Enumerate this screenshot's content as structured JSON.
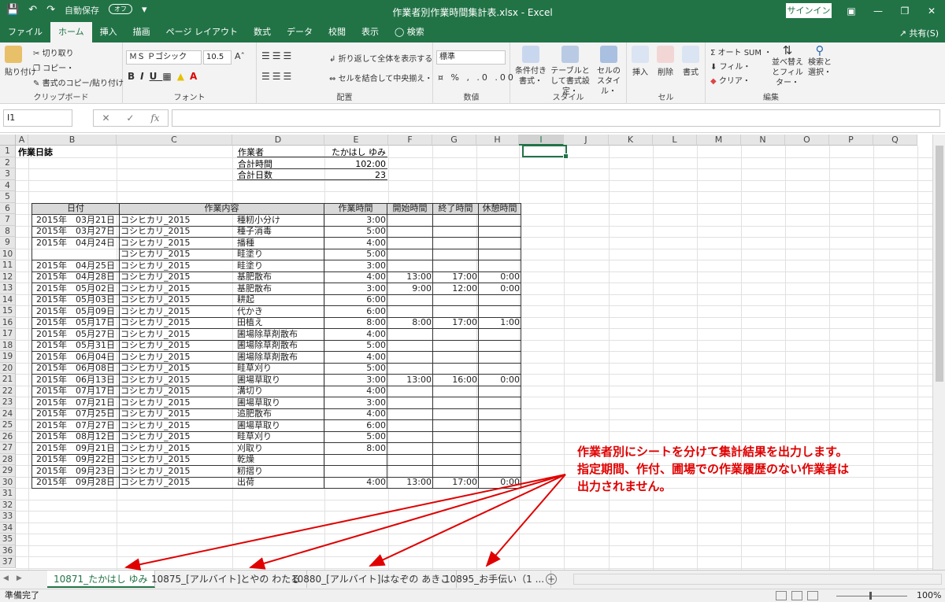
{
  "window": {
    "title": "作業者別作業時間集計表.xlsx  -  Excel",
    "autosave_label": "自動保存",
    "autosave_state": "オフ",
    "signin_label": "サインイン"
  },
  "menu": {
    "tabs": [
      "ファイル",
      "ホーム",
      "挿入",
      "描画",
      "ページ レイアウト",
      "数式",
      "データ",
      "校閲",
      "表示",
      "検索"
    ],
    "share_label": "共有(S)"
  },
  "ribbon": {
    "clipboard": {
      "paste": "貼り付け",
      "cut": "切り取り",
      "copy": "コピー・",
      "format_painter": "書式のコピー/貼り付け",
      "label": "クリップボード"
    },
    "font": {
      "name": "ＭＳ Ｐゴシック",
      "size": "10.5",
      "label": "フォント"
    },
    "alignment": {
      "wrap": "折り返して全体を表示する",
      "merge": "セルを結合して中央揃え・",
      "label": "配置"
    },
    "number": {
      "format": "標準",
      "label": "数値"
    },
    "styles": {
      "cond": "条件付き書式・",
      "table": "テーブルとして書式設定・",
      "cell": "セルのスタイル・",
      "label": "スタイル"
    },
    "cells": {
      "insert": "挿入",
      "delete": "削除",
      "format": "書式",
      "label": "セル"
    },
    "editing": {
      "autosum": "オート SUM ・",
      "fill": "フィル・",
      "clear": "クリア・",
      "sort": "並べ替えとフィルター・",
      "find": "検索と選択・",
      "label": "編集"
    }
  },
  "formula_bar": {
    "name_box": "I1",
    "cancel": "✕",
    "enter": "✓",
    "fx": "fx",
    "formula": ""
  },
  "columns": [
    "A",
    "B",
    "C",
    "D",
    "E",
    "F",
    "G",
    "H",
    "I",
    "J",
    "K",
    "L",
    "M",
    "N",
    "O",
    "P",
    "Q"
  ],
  "rows": [
    "1",
    "2",
    "3",
    "4",
    "5",
    "6",
    "7",
    "8",
    "9",
    "10",
    "11",
    "12",
    "13",
    "14",
    "15",
    "16",
    "17",
    "18",
    "19",
    "20",
    "21",
    "22",
    "23",
    "24",
    "25",
    "26",
    "27",
    "28",
    "29",
    "30",
    "31",
    "32",
    "33",
    "34",
    "35",
    "36",
    "37"
  ],
  "sheet": {
    "title": "作業日誌",
    "summary": [
      {
        "label": "作業者",
        "value": "たかはし ゆみ"
      },
      {
        "label": "合計時間",
        "value": "102:00"
      },
      {
        "label": "合計日数",
        "value": "23"
      }
    ],
    "headers": [
      "日付",
      "作業内容",
      "作業時間",
      "開始時間",
      "終了時間",
      "休憩時間"
    ],
    "records": [
      {
        "date": "2015年　03月21日",
        "crop": "コシヒカリ_2015",
        "task": "種籾小分け",
        "hours": "3:00",
        "start": "",
        "end": "",
        "break": ""
      },
      {
        "date": "2015年　03月27日",
        "crop": "コシヒカリ_2015",
        "task": "種子消毒",
        "hours": "5:00",
        "start": "",
        "end": "",
        "break": ""
      },
      {
        "date": "2015年　04月24日",
        "crop": "コシヒカリ_2015",
        "task": "播種",
        "hours": "4:00",
        "start": "",
        "end": "",
        "break": ""
      },
      {
        "date": "",
        "crop": "コシヒカリ_2015",
        "task": "畦塗り",
        "hours": "5:00",
        "start": "",
        "end": "",
        "break": ""
      },
      {
        "date": "2015年　04月25日",
        "crop": "コシヒカリ_2015",
        "task": "畦塗り",
        "hours": "3:00",
        "start": "",
        "end": "",
        "break": ""
      },
      {
        "date": "2015年　04月28日",
        "crop": "コシヒカリ_2015",
        "task": "基肥散布",
        "hours": "4:00",
        "start": "13:00",
        "end": "17:00",
        "break": "0:00"
      },
      {
        "date": "2015年　05月02日",
        "crop": "コシヒカリ_2015",
        "task": "基肥散布",
        "hours": "3:00",
        "start": "9:00",
        "end": "12:00",
        "break": "0:00"
      },
      {
        "date": "2015年　05月03日",
        "crop": "コシヒカリ_2015",
        "task": "耕起",
        "hours": "6:00",
        "start": "",
        "end": "",
        "break": ""
      },
      {
        "date": "2015年　05月09日",
        "crop": "コシヒカリ_2015",
        "task": "代かき",
        "hours": "6:00",
        "start": "",
        "end": "",
        "break": ""
      },
      {
        "date": "2015年　05月17日",
        "crop": "コシヒカリ_2015",
        "task": "田植え",
        "hours": "8:00",
        "start": "8:00",
        "end": "17:00",
        "break": "1:00"
      },
      {
        "date": "2015年　05月27日",
        "crop": "コシヒカリ_2015",
        "task": "圃場除草剤散布",
        "hours": "4:00",
        "start": "",
        "end": "",
        "break": ""
      },
      {
        "date": "2015年　05月31日",
        "crop": "コシヒカリ_2015",
        "task": "圃場除草剤散布",
        "hours": "5:00",
        "start": "",
        "end": "",
        "break": ""
      },
      {
        "date": "2015年　06月04日",
        "crop": "コシヒカリ_2015",
        "task": "圃場除草剤散布",
        "hours": "4:00",
        "start": "",
        "end": "",
        "break": ""
      },
      {
        "date": "2015年　06月08日",
        "crop": "コシヒカリ_2015",
        "task": "畦草刈り",
        "hours": "5:00",
        "start": "",
        "end": "",
        "break": ""
      },
      {
        "date": "2015年　06月13日",
        "crop": "コシヒカリ_2015",
        "task": "圃場草取り",
        "hours": "3:00",
        "start": "13:00",
        "end": "16:00",
        "break": "0:00"
      },
      {
        "date": "2015年　07月17日",
        "crop": "コシヒカリ_2015",
        "task": "溝切り",
        "hours": "4:00",
        "start": "",
        "end": "",
        "break": ""
      },
      {
        "date": "2015年　07月21日",
        "crop": "コシヒカリ_2015",
        "task": "圃場草取り",
        "hours": "3:00",
        "start": "",
        "end": "",
        "break": ""
      },
      {
        "date": "2015年　07月25日",
        "crop": "コシヒカリ_2015",
        "task": "追肥散布",
        "hours": "4:00",
        "start": "",
        "end": "",
        "break": ""
      },
      {
        "date": "2015年　07月27日",
        "crop": "コシヒカリ_2015",
        "task": "圃場草取り",
        "hours": "6:00",
        "start": "",
        "end": "",
        "break": ""
      },
      {
        "date": "2015年　08月12日",
        "crop": "コシヒカリ_2015",
        "task": "畦草刈り",
        "hours": "5:00",
        "start": "",
        "end": "",
        "break": ""
      },
      {
        "date": "2015年　09月21日",
        "crop": "コシヒカリ_2015",
        "task": "刈取り",
        "hours": "8:00",
        "start": "",
        "end": "",
        "break": ""
      },
      {
        "date": "2015年　09月22日",
        "crop": "コシヒカリ_2015",
        "task": "乾燥",
        "hours": "",
        "start": "",
        "end": "",
        "break": ""
      },
      {
        "date": "2015年　09月23日",
        "crop": "コシヒカリ_2015",
        "task": "籾摺り",
        "hours": "",
        "start": "",
        "end": "",
        "break": ""
      },
      {
        "date": "2015年　09月28日",
        "crop": "コシヒカリ_2015",
        "task": "出荷",
        "hours": "4:00",
        "start": "13:00",
        "end": "17:00",
        "break": "0:00"
      }
    ]
  },
  "sheet_tabs": [
    "10871_たかはし ゆみ",
    "10875_[アルバイト]とやの わたる",
    "10880_[アルバイト]はなぞの あきこ",
    "10895_お手伝い（1 ..."
  ],
  "annotation": {
    "lines": [
      "作業者別にシートを分けて集計結果を出力します。",
      "指定期間、作付、圃場での作業履歴のない作業者は",
      "出力されません。"
    ],
    "color": "#e00000"
  },
  "status": {
    "ready": "準備完了",
    "zoom": "100%"
  },
  "colors": {
    "excel_green": "#217346",
    "header_gray": "#d9d9d9"
  }
}
